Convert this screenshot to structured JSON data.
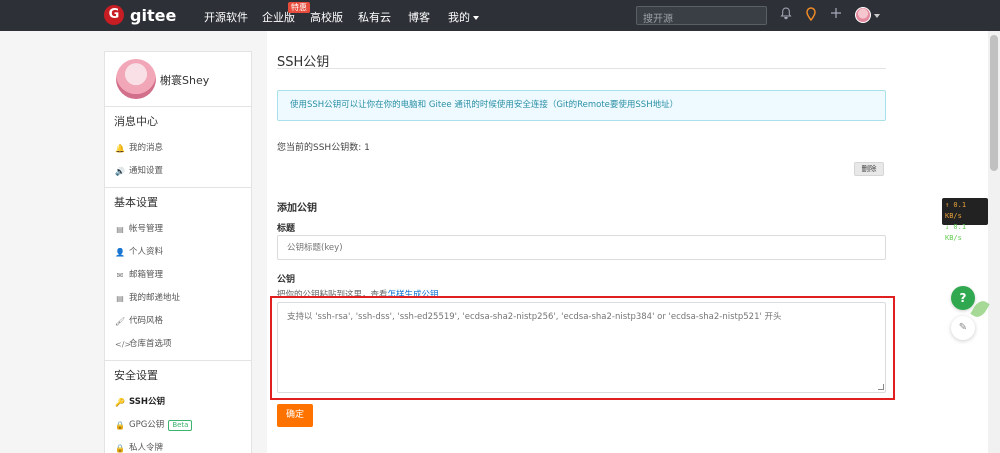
{
  "topnav": {
    "logo_letter": "G",
    "logo_text": "gitee",
    "items": [
      "开源软件",
      "企业版",
      "高校版",
      "私有云",
      "博客",
      "我的"
    ],
    "enterprise_badge": "特惠",
    "search_placeholder": "搜开源",
    "icons": [
      "bell-icon",
      "location-icon",
      "plus-icon"
    ]
  },
  "sidebar": {
    "username": "榭寰Shey",
    "sections": [
      {
        "title": "消息中心",
        "items": [
          {
            "label": "我的消息",
            "icon": "🔔"
          },
          {
            "label": "通知设置",
            "icon": "🔊"
          }
        ]
      },
      {
        "title": "基本设置",
        "items": [
          {
            "label": "帐号管理",
            "icon": "▤"
          },
          {
            "label": "个人资料",
            "icon": "👤"
          },
          {
            "label": "邮箱管理",
            "icon": "✉"
          },
          {
            "label": "我的邮递地址",
            "icon": "▤"
          },
          {
            "label": "代码风格",
            "icon": "🖌"
          },
          {
            "label": "仓库首选项",
            "icon": "</>"
          }
        ]
      },
      {
        "title": "安全设置",
        "items": [
          {
            "label": "SSH公钥",
            "icon": "🔑"
          },
          {
            "label": "GPG公钥",
            "icon": "🔒",
            "badge": "Beta"
          },
          {
            "label": "私人令牌",
            "icon": "🔒"
          }
        ]
      }
    ]
  },
  "main": {
    "title": "SSH公钥",
    "info": "使用SSH公钥可以让你在你的电脑和 Gitee 通讯的时候使用安全连接（Git的Remote要使用SSH地址）",
    "key_count": "您当前的SSH公钥数: 1",
    "delete_label": "删除",
    "add_heading": "添加公钥",
    "title_label": "标题",
    "title_placeholder": "公钥标题(key)",
    "key_label": "公钥",
    "hint_prefix": "把你的公钥粘贴到这里，查看",
    "hint_link": "怎样生成公钥",
    "key_placeholder": "支持以 'ssh-rsa', 'ssh-dss', 'ssh-ed25519', 'ecdsa-sha2-nistp256', 'ecdsa-sha2-nistp384' or 'ecdsa-sha2-nistp521' 开头",
    "submit_label": "确定"
  },
  "net_widget": {
    "up": "↑ 0.1 KB/s",
    "down": "↓ 0.1 KB/s"
  },
  "floating": {
    "help": "?",
    "feedback": "✎"
  },
  "colors": {
    "nav_bg": "#2d3137",
    "brand_red": "#c71d23",
    "primary_orange": "#fe7300",
    "info_bg": "#eefaff",
    "highlight_red": "#e02020"
  }
}
